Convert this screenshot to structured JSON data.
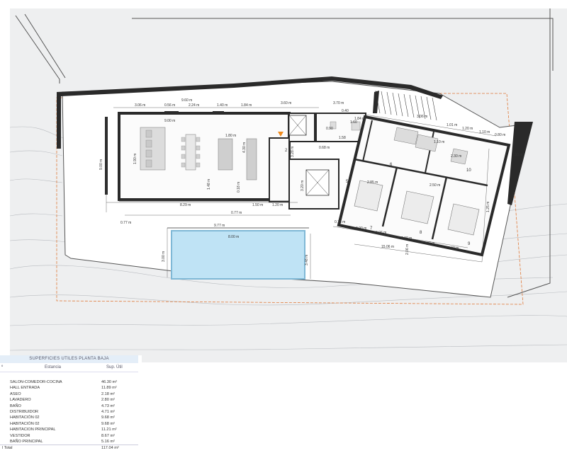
{
  "plan": {
    "colors": {
      "background": "#ffffff",
      "terrain": "#eeeff0",
      "wall": "#2a2a2a",
      "pool": "#bfe3f5",
      "pool_edge": "#7fb8d6",
      "boundary": "#e07a3a",
      "marker": "#f08a1c"
    },
    "dimensions_top": [
      "3.06 m",
      "0.56 m",
      "2.24 m",
      "1.40 m",
      "1.84 m",
      "9.60 m",
      "3.60 m",
      "3.70 m",
      "0.40",
      "3.06 m",
      "1.01 m",
      "1.20 m",
      "1.10 m",
      "0.80 m"
    ],
    "dimensions_inner": [
      "9.00 m",
      "1.80 m",
      "1.84 m",
      "0.90",
      "1.58",
      "1.60",
      "2.30 m",
      "2.50 m",
      "2.85 m",
      "1.10 m",
      "0.68 m"
    ],
    "dimensions_side": [
      "9.00 m",
      "1.90 m",
      "1.48 m",
      "0.18 m",
      "4.30 m",
      "3.20 m",
      "3.28 m",
      "3.00 m",
      "3.48 m",
      "2.30 m",
      "1.25 m",
      "2.06 m"
    ],
    "dimensions_bottom": [
      "8.29 m",
      "1.50 m",
      "1.20 m",
      "0.77 m",
      "0.77 m",
      "0.73 m",
      "2.00 m",
      "0.96 m",
      "2.00 m",
      "2.02 m",
      "2.00 m",
      "15.06 m"
    ],
    "dimensions_pool": [
      "9.77 m",
      "8.00 m",
      "3.00 m",
      "3.48 m"
    ],
    "room_numbers": [
      "2",
      "5",
      "6",
      "7",
      "8",
      "9",
      "10"
    ]
  },
  "table": {
    "title": "SUPERFICIES UTILES PLANTA BAJA",
    "col_n": "º",
    "col_name": "Estancia",
    "col_area": "Sup. Útil",
    "rows": [
      {
        "name": "SALON-COMEDOR-COCINA",
        "area": "46.30 m²"
      },
      {
        "name": "HALL ENTRADA",
        "area": "11.89 m²"
      },
      {
        "name": "ASEO",
        "area": "2.18 m²"
      },
      {
        "name": "LAVADERO",
        "area": "2.80 m²"
      },
      {
        "name": "BAÑO",
        "area": "4.73 m²"
      },
      {
        "name": "DISTRIBUIDOR",
        "area": "4.71 m²"
      },
      {
        "name": "HABITACIÓN 02",
        "area": "9.68 m²"
      },
      {
        "name": "HABITACIÓN 02",
        "area": "9.68 m²"
      },
      {
        "name": "HABITACION PRINCIPAL",
        "area": "11.21 m²"
      },
      {
        "name": "VESTIDOR",
        "area": "8.67 m²"
      },
      {
        "name": "BAÑO PRINCIPAL",
        "area": "5.16 m²"
      }
    ],
    "total": {
      "name": "l Total",
      "area": "117.04 m²"
    }
  }
}
